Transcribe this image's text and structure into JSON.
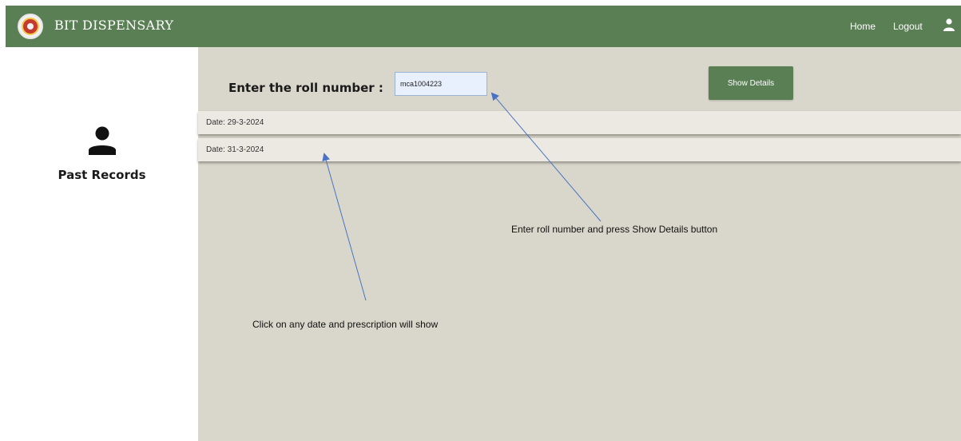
{
  "navbar": {
    "brand": "BIT DISPENSARY",
    "home_label": "Home",
    "logout_label": "Logout",
    "bg_color": "#5a7f55"
  },
  "sidebar": {
    "title": "Past Records",
    "icon": "user-icon"
  },
  "main": {
    "roll_label": "Enter the roll number :",
    "roll_value": "mca1004223",
    "show_button": "Show Details",
    "records": [
      {
        "label": "Date: 29-3-2024"
      },
      {
        "label": "Date: 31-3-2024"
      }
    ]
  },
  "annotations": {
    "enter_roll": "Enter roll number and press Show Details button",
    "click_date": "Click on any date and prescription will show",
    "arrow_color": "#4a72c4"
  }
}
